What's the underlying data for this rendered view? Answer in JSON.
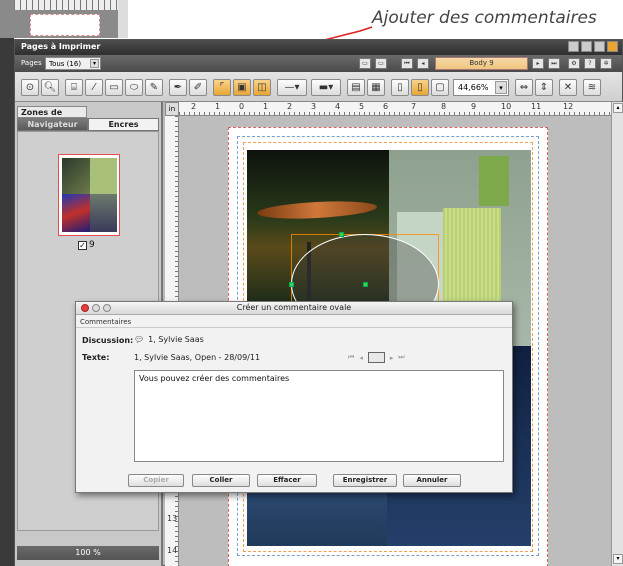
{
  "callout": {
    "text": "Ajouter des commentaires"
  },
  "app": {
    "title": "Pages à Imprimer",
    "pages_label": "Pages",
    "pages_select": "Tous (16)",
    "page_field": "Body 9",
    "zoom": "44,66%",
    "accent_color": "#e8a533"
  },
  "panel": {
    "tab_top": "Zones de page",
    "tabs": [
      "Navigateur",
      "Encres"
    ],
    "thumb_number": "9",
    "thumb_checked": "✓",
    "zoom_percent": "100 %"
  },
  "rulers": {
    "horizontal": [
      "in",
      "2",
      "1",
      "0",
      "1",
      "2",
      "3",
      "4",
      "5",
      "6",
      "7",
      "8",
      "9",
      "10",
      "11",
      "12"
    ],
    "vertical": [
      "13",
      "14"
    ]
  },
  "dialog": {
    "title": "Créer un commentaire ovale",
    "menu": "Commentaires",
    "discussion_label": "Discussion:",
    "discussion_value": "1, Sylvie Saas",
    "texte_label": "Texte:",
    "texte_value": "1, Sylvie Saas, Open - 28/09/11",
    "textarea_value": "Vous pouvez créer des commentaires",
    "buttons": {
      "copier": "Copier",
      "coller": "Coller",
      "effacer": "Effacer",
      "enregistrer": "Enregistrer",
      "annuler": "Annuler"
    }
  }
}
